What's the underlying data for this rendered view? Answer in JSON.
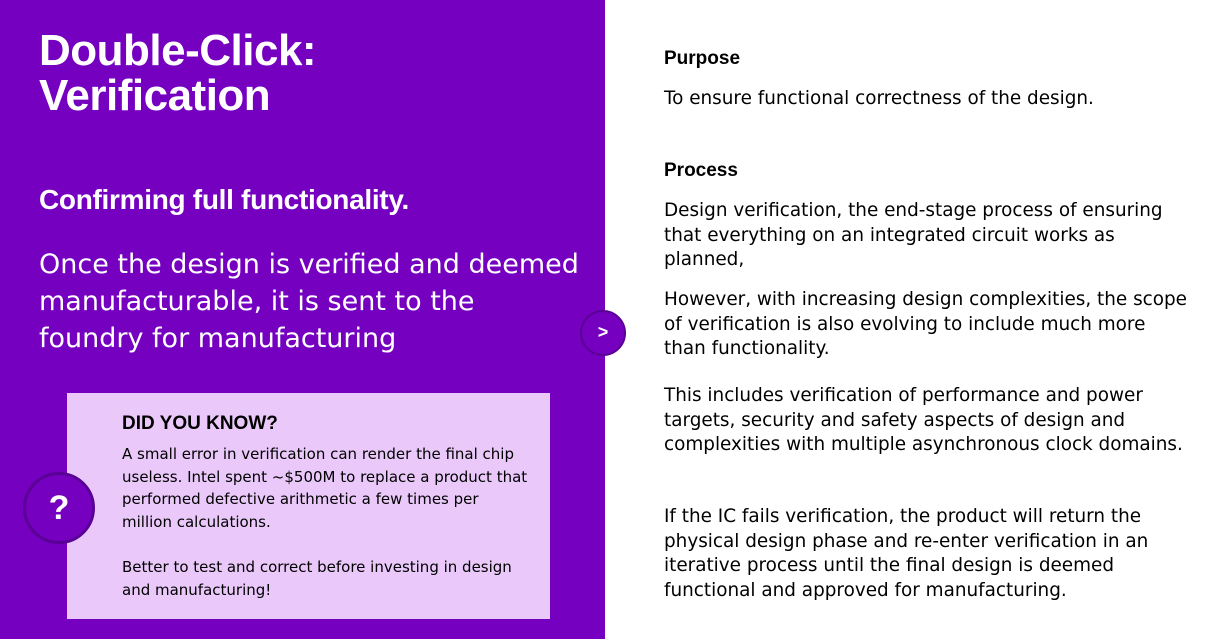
{
  "left": {
    "title_line1": "Double-Click:",
    "title_line2": "Verification",
    "subtitle": "Confirming full functionality.",
    "lead": "Once the design is verified and deemed manufacturable, it is sent to the foundry for manufacturing"
  },
  "did_you_know": {
    "title": "DID YOU KNOW?",
    "text1": "A small error in verification can render the final chip useless. Intel spent ~$500M to replace a product that performed defective arithmetic a few times per million calculations.",
    "text2": "Better to test and correct before investing in design and manufacturing!",
    "icon_glyph": "?"
  },
  "arrow": {
    "glyph": ">"
  },
  "right": {
    "purpose_heading": "Purpose",
    "purpose_text": "To ensure functional correctness of the design.",
    "process_heading": "Process",
    "process_p1": "Design verification, the end-stage process of ensuring that everything on an integrated circuit works as planned,",
    "process_p2": "However, with increasing design complexities, the scope of verification is also evolving to include much more than functionality.",
    "process_p3": "This includes verification of performance and power targets, security and safety aspects of design and complexities with multiple asynchronous clock domains.",
    "process_p4": "If the IC fails verification, the product will return the physical design phase and re-enter verification in an iterative process until the final design is deemed functional and approved for manufacturing."
  },
  "colors": {
    "purple": "#7500c0",
    "lavender": "#eac9fa",
    "white": "#ffffff",
    "text": "#000000"
  }
}
